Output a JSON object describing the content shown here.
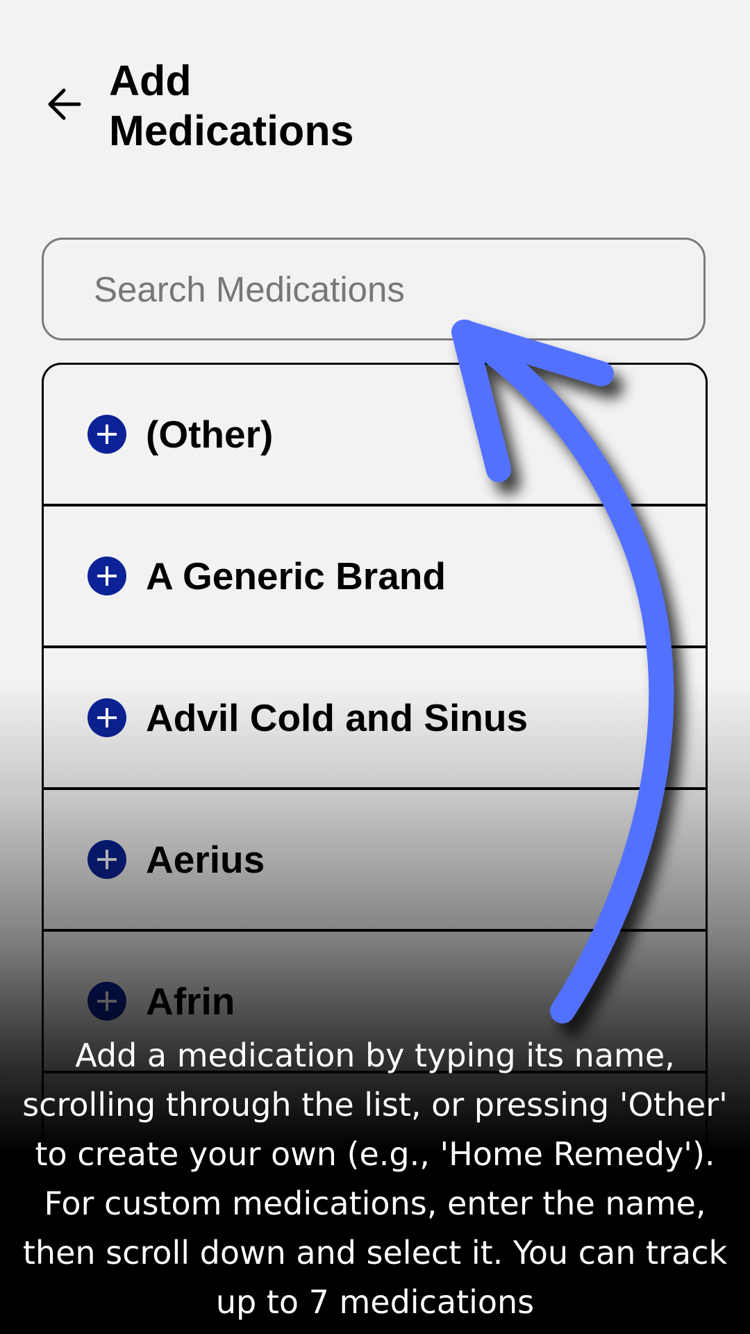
{
  "header": {
    "back_icon": "arrow-left-icon",
    "title": "Add Medications"
  },
  "search": {
    "placeholder": "Search Medications",
    "value": ""
  },
  "medications": [
    {
      "label": "(Other)",
      "icon": "plus-circle-icon"
    },
    {
      "label": "A Generic Brand",
      "icon": "plus-circle-icon"
    },
    {
      "label": "Advil Cold and Sinus",
      "icon": "plus-circle-icon"
    },
    {
      "label": "Aerius",
      "icon": "plus-circle-icon"
    },
    {
      "label": "Afrin",
      "icon": "plus-circle-icon"
    }
  ],
  "overlay": {
    "caption": "Add a medication by typing its name, scrolling through the list, or pressing 'Other' to create your own (e.g., 'Home Remedy'). For custom medications, enter the name, then scroll down and select it. You can track up to 7 medications",
    "arrow_icon": "curved-arrow-up-icon"
  },
  "colors": {
    "background": "#f2f2f2",
    "accent_icon": "#0b2396",
    "hint_arrow": "#5271ff"
  }
}
